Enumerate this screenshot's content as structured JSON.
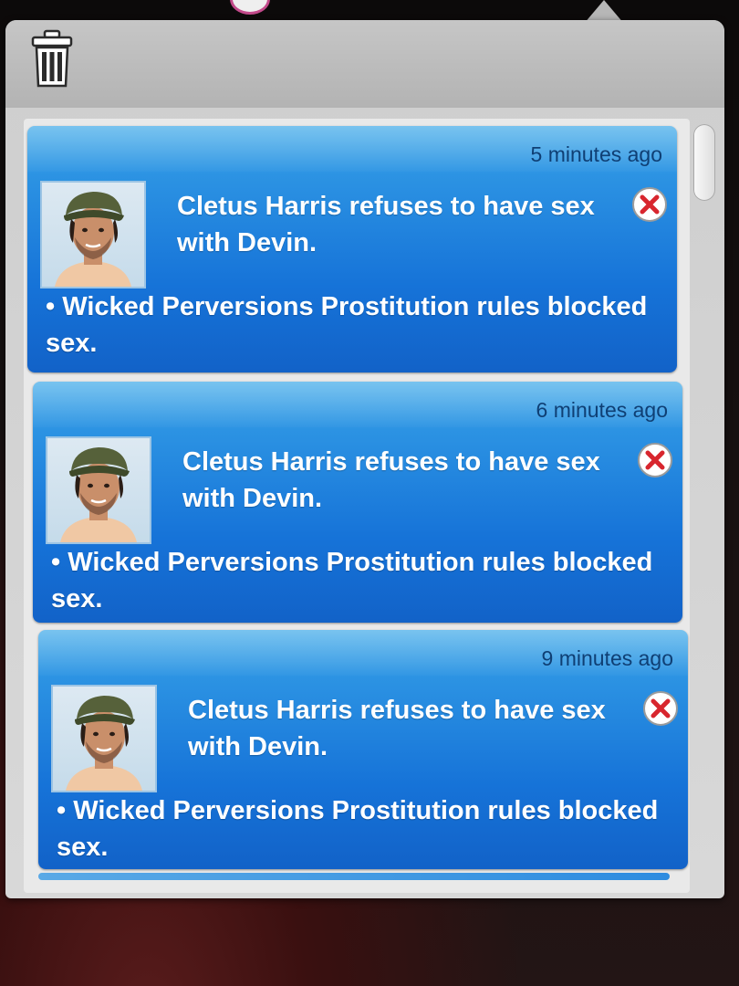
{
  "notifications": [
    {
      "timestamp": "5 minutes ago",
      "headline": "Cletus Harris refuses to have sex with Devin.",
      "body": "• Wicked Perversions Prostitution rules blocked sex."
    },
    {
      "timestamp": "6 minutes ago",
      "headline": "Cletus Harris refuses to have sex with Devin.",
      "body": "• Wicked Perversions Prostitution rules blocked sex."
    },
    {
      "timestamp": "9 minutes ago",
      "headline": "Cletus Harris refuses to have sex with Devin.",
      "body": "• Wicked Perversions Prostitution rules blocked sex."
    }
  ],
  "icons": {
    "trash": "trash-icon",
    "close": "close-icon",
    "avatar": "sim-portrait"
  },
  "colors": {
    "card_blue": "#1673d8",
    "card_light": "#5bb6ec",
    "timestamp_text": "#0f3f74",
    "close_red": "#d8262e",
    "panel_gray": "#cfcfcf"
  }
}
